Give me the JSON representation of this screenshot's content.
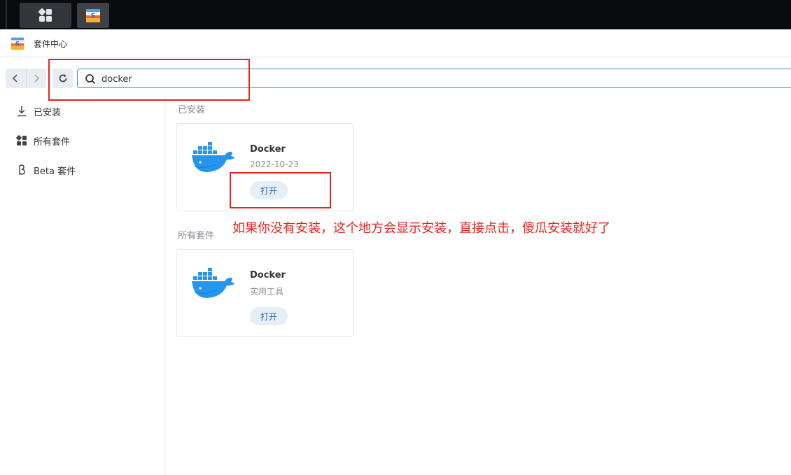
{
  "window": {
    "title": "套件中心"
  },
  "toolbar": {
    "search_value": "docker"
  },
  "sidebar": {
    "items": [
      {
        "label": "已安装",
        "icon": "download-icon"
      },
      {
        "label": "所有套件",
        "icon": "grid-icon"
      },
      {
        "label": "Beta 套件",
        "icon": "beta-icon"
      }
    ]
  },
  "installed": {
    "title": "已安装",
    "card": {
      "name": "Docker",
      "subtitle": "2022-10-23",
      "button": "打开"
    }
  },
  "all": {
    "title": "所有套件",
    "card": {
      "name": "Docker",
      "subtitle": "实用工具",
      "button": "打开"
    }
  },
  "annotation": {
    "text": "如果你没有安装，这个地方会显示安装，直接点击，傻瓜安装就好了"
  },
  "colors": {
    "accent": "#3d8fc9",
    "annotation": "#e8231c",
    "docker_blue": "#2496ed"
  }
}
